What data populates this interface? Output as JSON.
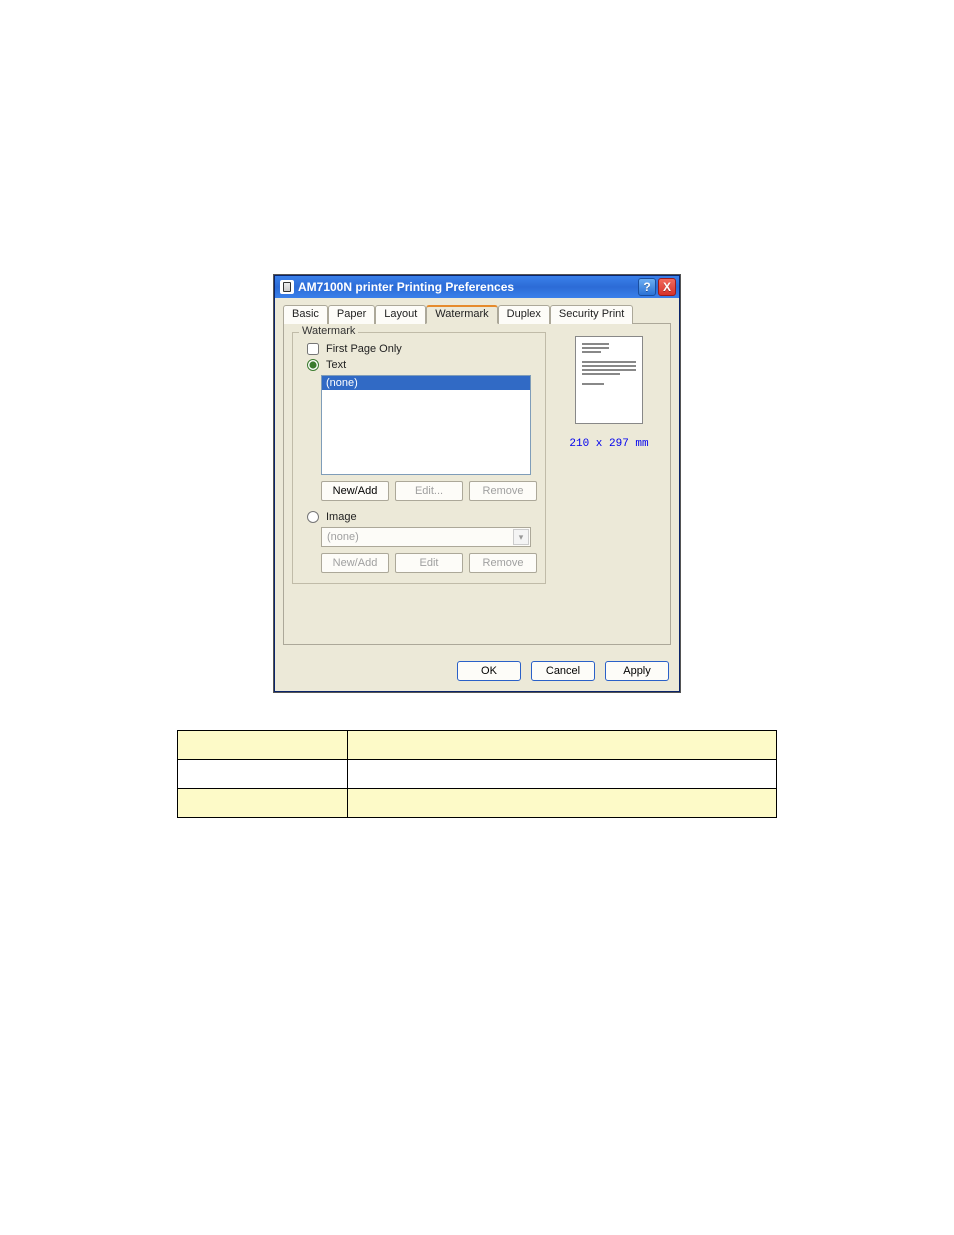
{
  "dialog": {
    "title": "AM7100N printer Printing Preferences",
    "help_glyph": "?",
    "close_glyph": "X",
    "tabs": [
      "Basic",
      "Paper",
      "Layout",
      "Watermark",
      "Duplex",
      "Security Print"
    ],
    "active_tab_index": 3,
    "watermark": {
      "group_title": "Watermark",
      "first_page_only": "First Page Only",
      "text_label": "Text",
      "text_selected": "(none)",
      "text_buttons": {
        "new": "New/Add",
        "edit": "Edit...",
        "remove": "Remove"
      },
      "image_label": "Image",
      "image_selected": "(none)",
      "image_buttons": {
        "new": "New/Add",
        "edit": "Edit",
        "remove": "Remove"
      }
    },
    "preview_dimensions": "210 x 297 mm",
    "footer": {
      "ok": "OK",
      "cancel": "Cancel",
      "apply": "Apply"
    }
  }
}
